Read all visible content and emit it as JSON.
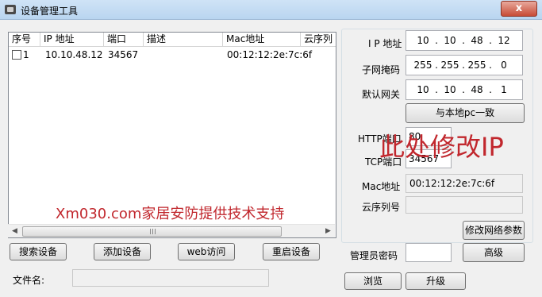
{
  "window": {
    "title": "设备管理工具",
    "close_symbol": "x"
  },
  "device_list": {
    "columns": [
      "序号",
      "IP 地址",
      "端口",
      "描述",
      "Mac地址",
      "云序列"
    ],
    "rows": [
      {
        "index": "1",
        "ip": "10.10.48.12",
        "port": "34567",
        "desc": "",
        "mac": "00:12:12:2e:7c:6f",
        "cloud": ""
      }
    ],
    "overlay_text": "Xm030.com家居安防提供技术支持"
  },
  "buttons": {
    "search": "搜索设备",
    "add": "添加设备",
    "web": "web访问",
    "reboot": "重启设备",
    "same_as_local": "与本地pc一致",
    "modify_net": "修改网络参数",
    "advanced": "高级",
    "browse": "浏览",
    "upgrade": "升级"
  },
  "network": {
    "ip_label": "I P 地址",
    "ip": [
      "10",
      "10",
      "48",
      "12"
    ],
    "mask_label": "子网掩码",
    "mask": [
      "255",
      "255",
      "255",
      "0"
    ],
    "gateway_label": "默认网关",
    "gateway": [
      "10",
      "10",
      "48",
      "1"
    ],
    "http_label": "HTTP端口",
    "http_port": "80",
    "tcp_label": "TCP端口",
    "tcp_port": "34567",
    "mac_label": "Mac地址",
    "mac": "00:12:12:2e:7c:6f",
    "cloud_label": "云序列号",
    "cloud": "",
    "admin_pwd_label": "管理员密码",
    "admin_pwd": "",
    "overlay_text": "此处修改IP"
  },
  "file": {
    "label": "文件名:",
    "value": ""
  }
}
